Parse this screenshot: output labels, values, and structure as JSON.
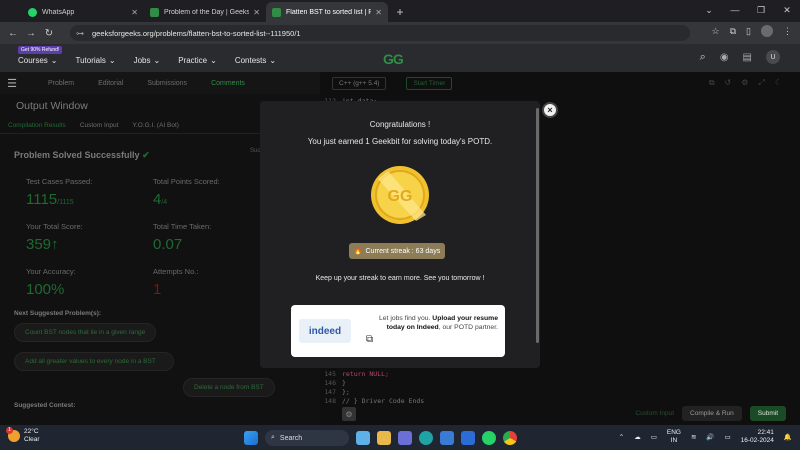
{
  "browser": {
    "tabs": [
      {
        "label": "WhatsApp",
        "color": "#25d366"
      },
      {
        "label": "Problem of the Day | GeeksforG",
        "color": "#2f8d46"
      },
      {
        "label": "Flatten BST to sorted list | Pract",
        "color": "#2f8d46"
      }
    ],
    "url": "geeksforgeeks.org/problems/flatten-bst-to-sorted-list--111950/1"
  },
  "gfg_nav": {
    "refund_badge": "Get 90% Refund!",
    "items": [
      "Courses",
      "Tutorials",
      "Jobs",
      "Practice",
      "Contests"
    ],
    "logo": "GG",
    "user_initial": "U"
  },
  "problem_tabs": [
    "Problem",
    "Editorial",
    "Submissions",
    "Comments"
  ],
  "output": {
    "title": "Output Window",
    "result_tabs": [
      "Compilation Results",
      "Custom Input",
      "Y.O.G.I. (AI Bot)"
    ],
    "hidden_label": "Suc",
    "status": "Problem Solved Successfully",
    "stats": [
      {
        "label": "Test Cases Passed:",
        "value": "1115",
        "suffix": "/1115"
      },
      {
        "label": "Total Points Scored:",
        "value": "4",
        "suffix": "/4"
      },
      {
        "label": "Your Total Score:",
        "value": "359",
        "suffix": "↑"
      },
      {
        "label": "Total Time Taken:",
        "value": "0.07",
        "suffix": ""
      },
      {
        "label": "Your Accuracy:",
        "value": "100%",
        "suffix": ""
      },
      {
        "label": "Attempts No.:",
        "value": "1",
        "suffix": ""
      }
    ],
    "suggested_title": "Next Suggested Problem(s):",
    "suggested": [
      "Count BST nodes that lie in a given range",
      "Add all greater values to every node in a BST",
      "Delete a node from BST"
    ],
    "contest_title": "Suggested Contest:"
  },
  "editor": {
    "language": "C++ (g++ 5.4)",
    "timer": "Start Timer",
    "lines": [
      {
        "n": "112",
        "text": "    int data;"
      },
      {
        "n": "145",
        "text": "        return NULL;"
      },
      {
        "n": "146",
        "text": "    }"
      },
      {
        "n": "147",
        "text": "};"
      },
      {
        "n": "148",
        "text": "// } Driver Code Ends"
      }
    ],
    "custom_input": "Custom Input",
    "compile": "Compile & Run",
    "submit": "Submit"
  },
  "modal": {
    "title": "Congratulations !",
    "subtitle": "You just earned 1 Geekbit for solving today's POTD.",
    "streak": "Current streak : 63 days",
    "keep_up": "Keep up your streak to earn more. See you tomorrow !",
    "ad_logo": "indeed",
    "ad_pre": "Let jobs find you. ",
    "ad_bold": "Upload your resume today on Indeed",
    "ad_post": ", our POTD partner.",
    "close": "×"
  },
  "taskbar": {
    "temp": "22°C",
    "condition": "Clear",
    "search": "Search",
    "lang1": "ENG",
    "lang2": "IN",
    "time": "22:41",
    "date": "16-02-2024",
    "notif": "1"
  }
}
